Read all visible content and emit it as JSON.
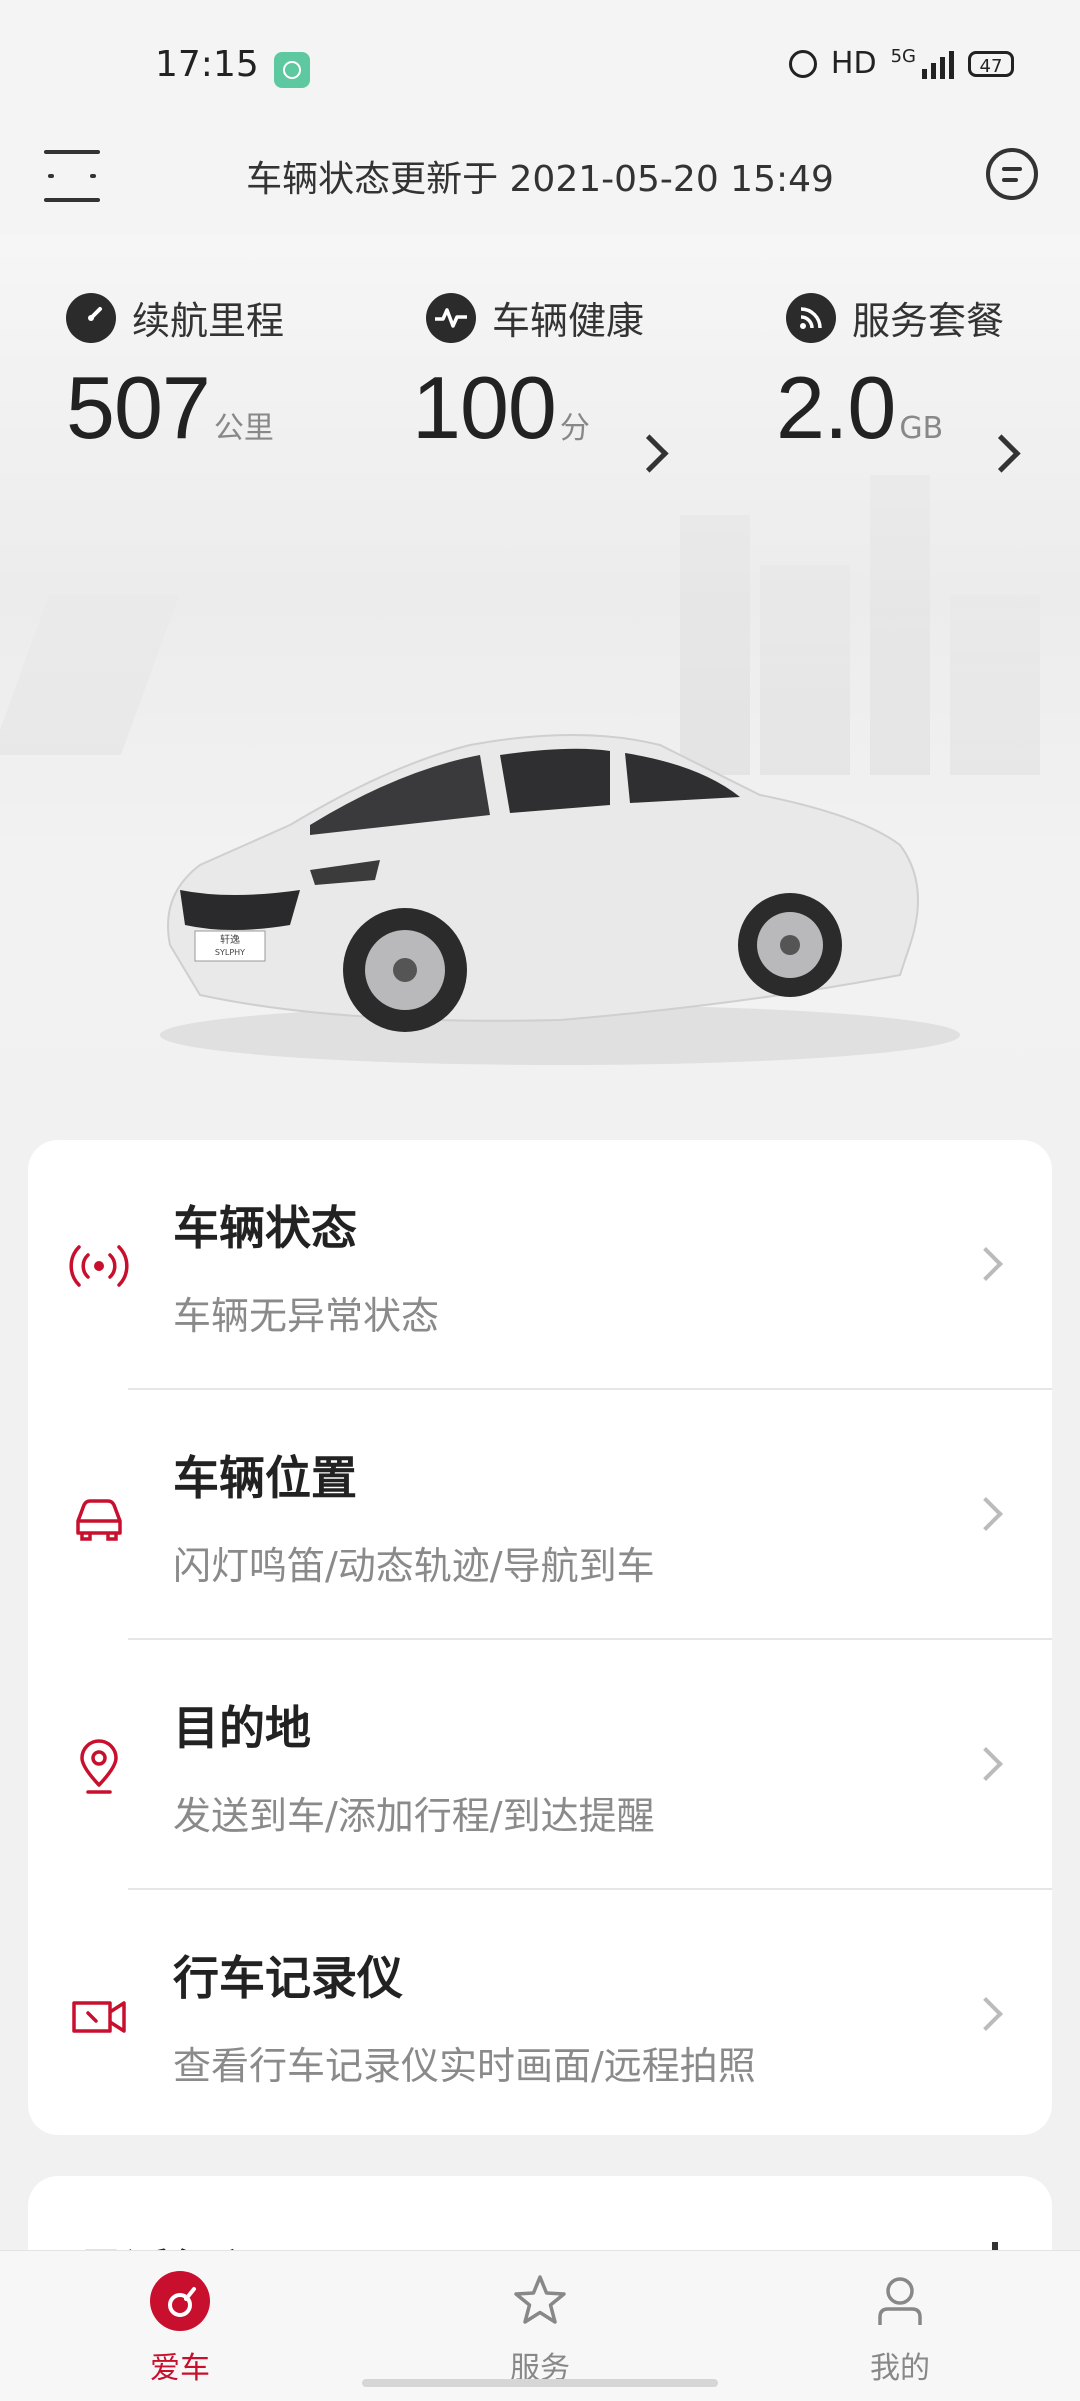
{
  "status_bar": {
    "time": "17:15",
    "network": "HD",
    "network_gen": "5G",
    "battery": "47"
  },
  "header": {
    "title": "车辆状态更新于  2021-05-20 15:49"
  },
  "stats": [
    {
      "label": "续航里程",
      "value": "507",
      "unit": "公里",
      "icon": "speedometer-icon"
    },
    {
      "label": "车辆健康",
      "value": "100",
      "unit": "分",
      "icon": "pulse-icon"
    },
    {
      "label": "服务套餐",
      "value": "2.0",
      "unit": "GB",
      "icon": "signal-icon"
    }
  ],
  "car": {
    "plate_text": "轩逸",
    "plate_sub": "SYLPHY"
  },
  "menu": [
    {
      "title": "车辆状态",
      "subtitle": "车辆无异常状态",
      "icon": "broadcast-icon"
    },
    {
      "title": "车辆位置",
      "subtitle": "闪灯鸣笛/动态轨迹/导航到车",
      "icon": "car-icon"
    },
    {
      "title": "目的地",
      "subtitle": "发送到车/添加行程/到达提醒",
      "icon": "location-pin-icon"
    },
    {
      "title": "行车记录仪",
      "subtitle": "查看行车记录仪实时画面/远程拍照",
      "icon": "video-camera-icon"
    }
  ],
  "recent": {
    "title": "最近行程"
  },
  "bottom_nav": [
    {
      "label": "爱车",
      "active": true
    },
    {
      "label": "服务",
      "active": false
    },
    {
      "label": "我的",
      "active": false
    }
  ],
  "colors": {
    "accent": "#c8102e",
    "background": "#f1f1f1",
    "card": "#ffffff"
  }
}
